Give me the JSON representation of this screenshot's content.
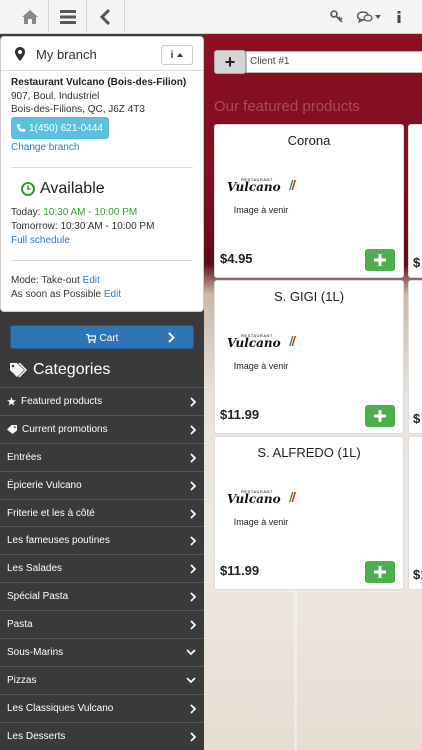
{
  "topbar": {
    "home_icon": "home-icon",
    "menu_icon": "hamburger-menu-icon",
    "back_icon": "chevron-left-icon",
    "key_icon": "key-icon",
    "chat_icon": "chat-bubbles-icon",
    "info_icon": "info-icon"
  },
  "branch": {
    "title": "My branch",
    "info_button": "i",
    "name": "Restaurant Vulcano (Bois-des-Filion)",
    "address1": "907, Boul. Industriel",
    "address2": "Bois-des-Filions, QC, J6Z 4T3",
    "phone": "1(450) 621-0444",
    "change_link": "Change branch",
    "status": "Available",
    "today_label": "Today:",
    "today_hours": "10:30 AM - 10:00 PM",
    "tomorrow_label": "Tomorrow:",
    "tomorrow_hours": "10:30 AM - 10:00 PM",
    "full_schedule": "Full schedule",
    "mode_label": "Mode: Take-out",
    "mode_edit": "Edit",
    "time_label": "As soon as Possible",
    "time_edit": "Edit"
  },
  "cart": {
    "label": "Cart"
  },
  "categories": {
    "title": "Categories",
    "items": [
      {
        "label": "Featured products",
        "icon": "star-icon",
        "arrow": "chevron-right-icon"
      },
      {
        "label": "Current promotions",
        "icon": "tag-icon",
        "arrow": "chevron-right-icon"
      },
      {
        "label": "Entrées",
        "arrow": "chevron-right-icon"
      },
      {
        "label": "Épicerie Vulcano",
        "arrow": "chevron-right-icon"
      },
      {
        "label": "Friterie et les à côté",
        "arrow": "chevron-right-icon"
      },
      {
        "label": "Les fameuses poutines",
        "arrow": "chevron-right-icon"
      },
      {
        "label": "Les Salades",
        "arrow": "chevron-right-icon"
      },
      {
        "label": "Spécial Pasta",
        "arrow": "chevron-right-icon"
      },
      {
        "label": "Pasta",
        "arrow": "chevron-right-icon"
      },
      {
        "label": "Sous-Marins",
        "arrow": "chevron-down-icon"
      },
      {
        "label": "Pizzas",
        "arrow": "chevron-down-icon"
      },
      {
        "label": "Les Classiques Vulcano",
        "arrow": "chevron-right-icon"
      },
      {
        "label": "Les Desserts",
        "arrow": "chevron-right-icon"
      }
    ]
  },
  "main": {
    "client_input": "Client #1",
    "featured_heading": "Our featured products",
    "products": [
      {
        "name": "Corona",
        "image_text": "Image à venir",
        "logo_text": "Vulcano",
        "logo_small": "RESTAURANT",
        "price": "$4.95"
      },
      {
        "name": "S. GIGI (1L)",
        "image_text": "Image à venir",
        "logo_text": "Vulcano",
        "logo_small": "RESTAURANT",
        "price": "$11.99"
      },
      {
        "name": "S. ALFREDO (1L)",
        "image_text": "Image à venir",
        "logo_text": "Vulcano",
        "logo_small": "RESTAURANT",
        "price": "$11.99"
      }
    ],
    "peek_prices": [
      "$",
      "$",
      "$1"
    ]
  },
  "colors": {
    "accent_blue": "#2f74b5",
    "add_green": "#4cae4c",
    "phone_blue": "#5bc0de",
    "available_green": "#3c9a3c",
    "sidebar_dark": "#3a3a3a"
  }
}
